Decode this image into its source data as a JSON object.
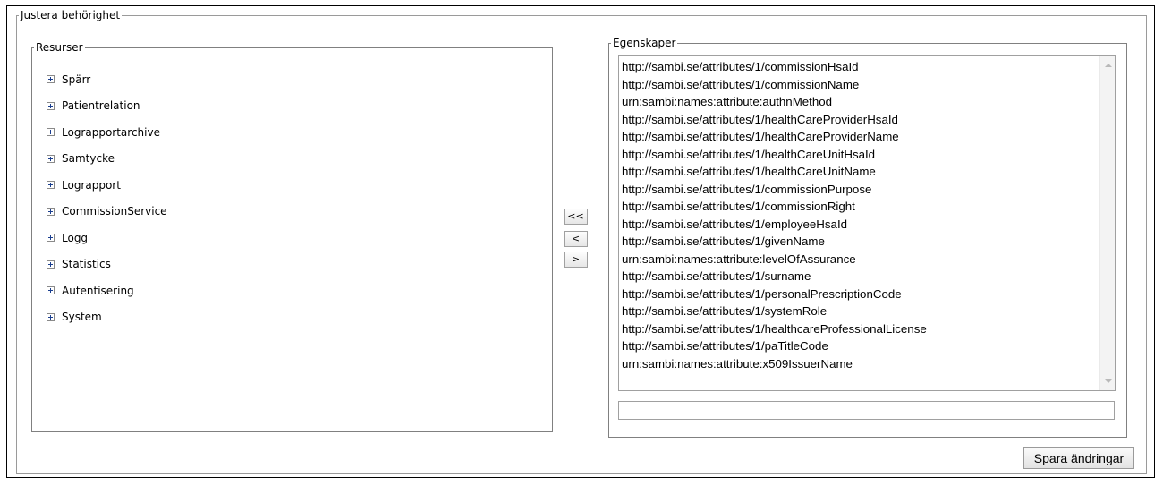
{
  "main": {
    "legend": "Justera behörighet"
  },
  "resources": {
    "legend": "Resurser",
    "items": [
      {
        "label": "Spärr"
      },
      {
        "label": "Patientrelation"
      },
      {
        "label": "Lograpportarchive"
      },
      {
        "label": "Samtycke"
      },
      {
        "label": "Lograpport"
      },
      {
        "label": "CommissionService"
      },
      {
        "label": "Logg"
      },
      {
        "label": "Statistics"
      },
      {
        "label": "Autentisering"
      },
      {
        "label": "System"
      }
    ]
  },
  "move_buttons": {
    "remove_all": "<<",
    "remove_one": "<",
    "add_one": ">"
  },
  "properties": {
    "legend": "Egenskaper",
    "attributes": [
      "http://sambi.se/attributes/1/commissionHsaId",
      "http://sambi.se/attributes/1/commissionName",
      "urn:sambi:names:attribute:authnMethod",
      "http://sambi.se/attributes/1/healthCareProviderHsaId",
      "http://sambi.se/attributes/1/healthCareProviderName",
      "http://sambi.se/attributes/1/healthCareUnitHsaId",
      "http://sambi.se/attributes/1/healthCareUnitName",
      "http://sambi.se/attributes/1/commissionPurpose",
      "http://sambi.se/attributes/1/commissionRight",
      "http://sambi.se/attributes/1/employeeHsaId",
      "http://sambi.se/attributes/1/givenName",
      "urn:sambi:names:attribute:levelOfAssurance",
      "http://sambi.se/attributes/1/surname",
      "http://sambi.se/attributes/1/personalPrescriptionCode",
      "http://sambi.se/attributes/1/systemRole",
      "http://sambi.se/attributes/1/healthcareProfessionalLicense",
      "http://sambi.se/attributes/1/paTitleCode",
      "urn:sambi:names:attribute:x509IssuerName"
    ],
    "input_value": ""
  },
  "save_label": "Spara ändringar"
}
